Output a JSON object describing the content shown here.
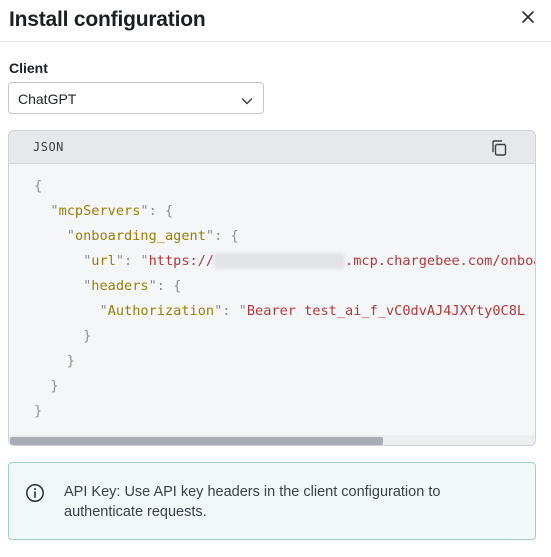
{
  "dialog": {
    "title": "Install configuration",
    "close_icon": "close-icon"
  },
  "client": {
    "label": "Client",
    "selected": "ChatGPT",
    "chevron_icon": "chevron-down-icon"
  },
  "code": {
    "language": "JSON",
    "copy_icon": "copy-icon",
    "lines": {
      "l1": "{",
      "l2_key": "mcpServers",
      "l3_key": "onboarding_agent",
      "l4_key": "url",
      "l4_prefix": "https://",
      "l4_suffix": ".mcp.chargebee.com/onboa",
      "l5_key": "headers",
      "l6_key": "Authorization",
      "l6_value": "Bearer test_ai_f_vC0dvAJ4JXYty0C8L",
      "l7": "}",
      "l8": "}",
      "l9": "}",
      "l10": "}"
    }
  },
  "info": {
    "icon": "info-icon",
    "text": "API Key: Use API key headers in the client configuration to authenticate requests."
  },
  "colors": {
    "key": "#9a7d08",
    "string": "#b1383a",
    "punctuation": "#8a8f95",
    "info_border": "#9fd0c8",
    "info_bg": "#f1f8f7"
  }
}
